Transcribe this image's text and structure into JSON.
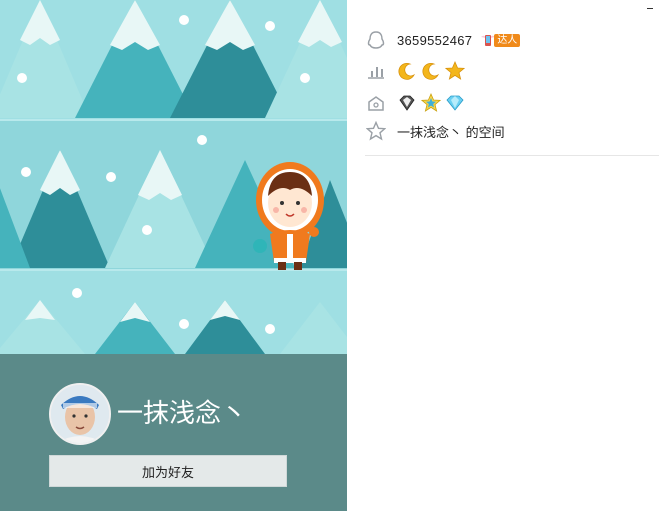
{
  "profile": {
    "nickname": "一抹浅念丶",
    "add_friend_label": "加为好友"
  },
  "info": {
    "qq_number": "3659552467",
    "badge_label": "达人",
    "level_icons": [
      "moon-icon",
      "moon-icon",
      "star-icon"
    ],
    "vip_icons": [
      "diamond-badge-icon",
      "star-badge-icon",
      "gem-icon"
    ],
    "space_label": "一抹浅念丶 的空间"
  },
  "colors": {
    "banner_bg": "#a6e0e4",
    "profile_bg": "#5b8a89",
    "accent_orange": "#f08a1a"
  }
}
